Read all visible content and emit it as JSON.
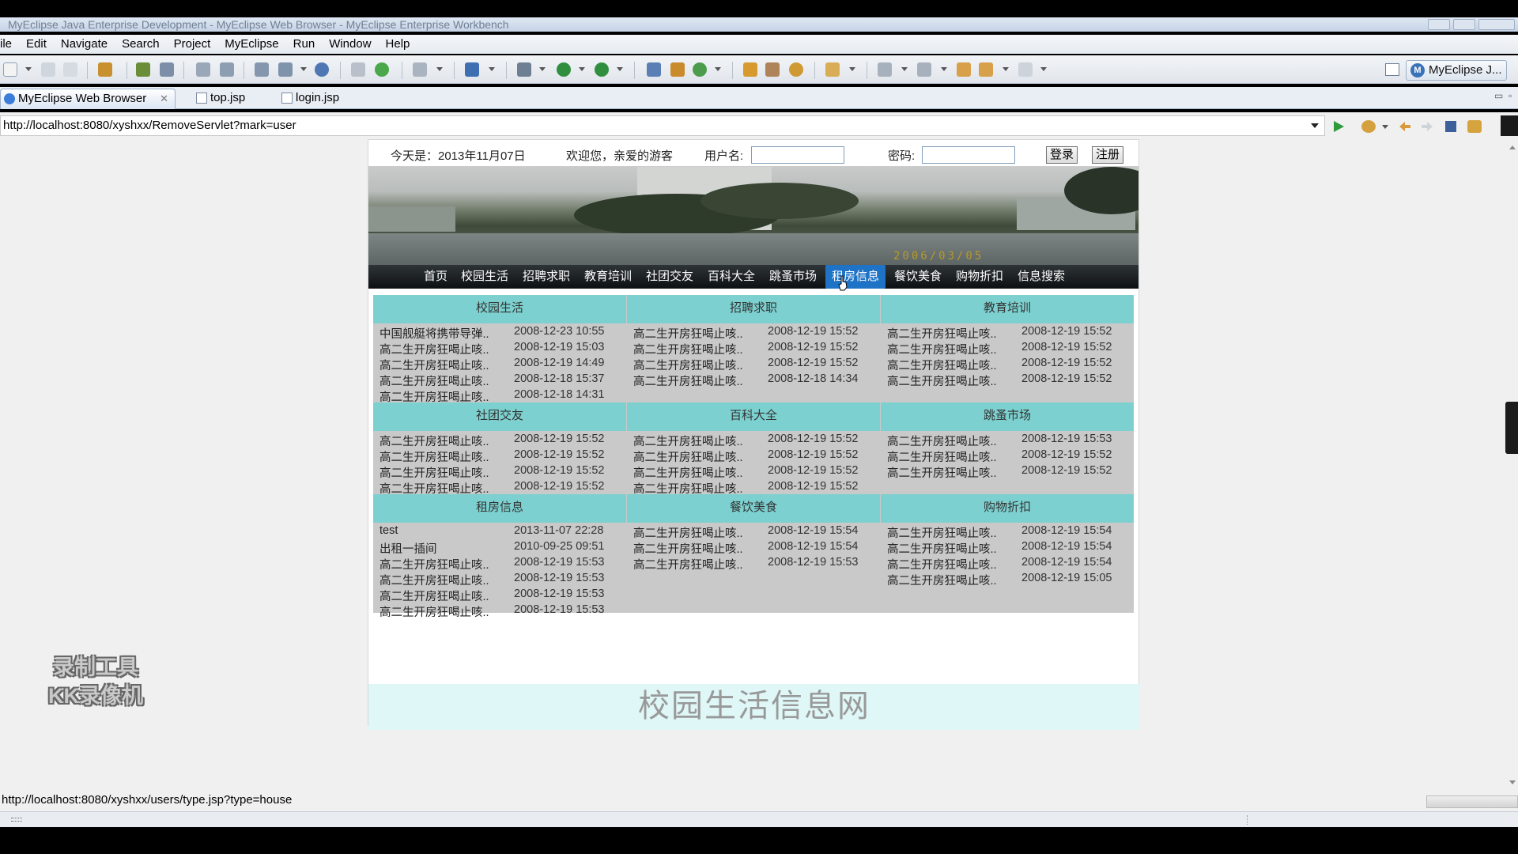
{
  "window": {
    "title": "MyEclipse Java Enterprise Development - MyEclipse Web Browser - MyEclipse Enterprise Workbench"
  },
  "menubar": [
    "ile",
    "Edit",
    "Navigate",
    "Search",
    "Project",
    "MyEclipse",
    "Run",
    "Window",
    "Help"
  ],
  "perspective": {
    "label": "MyEclipse J..."
  },
  "tabs": [
    {
      "label": "MyEclipse Web Browser",
      "close": "✕"
    },
    {
      "label": "top.jsp"
    },
    {
      "label": "login.jsp"
    }
  ],
  "address": {
    "url": "http://localhost:8080/xyshxx/RemoveServlet?mark=user"
  },
  "page": {
    "top": {
      "date_text": "今天是：2013年11月07日",
      "welcome": "欢迎您，亲爱的游客",
      "username_label": "用户名:",
      "username_value": "",
      "password_label": "密码:",
      "password_value": "",
      "login_button": "登录",
      "register_button": "注册"
    },
    "banner_date": "2006/03/05",
    "nav": [
      "首页",
      "校园生活",
      "招聘求职",
      "教育培训",
      "社团交友",
      "百科大全",
      "跳蚤市场",
      "租房信息",
      "餐饮美食",
      "购物折扣",
      "信息搜索"
    ],
    "active_nav": "租房信息",
    "sections": [
      {
        "title": "校园生活",
        "items": [
          {
            "t": "中国舰艇将携带导弹..",
            "d": "2008-12-23 10:55"
          },
          {
            "t": "高二生开房狂喝止咳..",
            "d": "2008-12-19 15:03"
          },
          {
            "t": "高二生开房狂喝止咳..",
            "d": "2008-12-19 14:49"
          },
          {
            "t": "高二生开房狂喝止咳..",
            "d": "2008-12-18 15:37"
          },
          {
            "t": "高二生开房狂喝止咳..",
            "d": "2008-12-18 14:31"
          }
        ]
      },
      {
        "title": "招聘求职",
        "items": [
          {
            "t": "高二生开房狂喝止咳..",
            "d": "2008-12-19 15:52"
          },
          {
            "t": "高二生开房狂喝止咳..",
            "d": "2008-12-19 15:52"
          },
          {
            "t": "高二生开房狂喝止咳..",
            "d": "2008-12-19 15:52"
          },
          {
            "t": "高二生开房狂喝止咳..",
            "d": "2008-12-18 14:34"
          }
        ]
      },
      {
        "title": "教育培训",
        "items": [
          {
            "t": "高二生开房狂喝止咳..",
            "d": "2008-12-19 15:52"
          },
          {
            "t": "高二生开房狂喝止咳..",
            "d": "2008-12-19 15:52"
          },
          {
            "t": "高二生开房狂喝止咳..",
            "d": "2008-12-19 15:52"
          },
          {
            "t": "高二生开房狂喝止咳..",
            "d": "2008-12-19 15:52"
          }
        ]
      },
      {
        "title": "社团交友",
        "items": [
          {
            "t": "高二生开房狂喝止咳..",
            "d": "2008-12-19 15:52"
          },
          {
            "t": "高二生开房狂喝止咳..",
            "d": "2008-12-19 15:52"
          },
          {
            "t": "高二生开房狂喝止咳..",
            "d": "2008-12-19 15:52"
          },
          {
            "t": "高二生开房狂喝止咳..",
            "d": "2008-12-19 15:52"
          }
        ]
      },
      {
        "title": "百科大全",
        "items": [
          {
            "t": "高二生开房狂喝止咳..",
            "d": "2008-12-19 15:52"
          },
          {
            "t": "高二生开房狂喝止咳..",
            "d": "2008-12-19 15:52"
          },
          {
            "t": "高二生开房狂喝止咳..",
            "d": "2008-12-19 15:52"
          },
          {
            "t": "高二生开房狂喝止咳..",
            "d": "2008-12-19 15:52"
          }
        ]
      },
      {
        "title": "跳蚤市场",
        "items": [
          {
            "t": "高二生开房狂喝止咳..",
            "d": "2008-12-19 15:53"
          },
          {
            "t": "高二生开房狂喝止咳..",
            "d": "2008-12-19 15:52"
          },
          {
            "t": "高二生开房狂喝止咳..",
            "d": "2008-12-19 15:52"
          }
        ]
      },
      {
        "title": "租房信息",
        "items": [
          {
            "t": "test",
            "d": "2013-11-07 22:28"
          },
          {
            "t": "出租一插间",
            "d": "2010-09-25 09:51"
          },
          {
            "t": "高二生开房狂喝止咳..",
            "d": "2008-12-19 15:53"
          },
          {
            "t": "高二生开房狂喝止咳..",
            "d": "2008-12-19 15:53"
          },
          {
            "t": "高二生开房狂喝止咳..",
            "d": "2008-12-19 15:53"
          },
          {
            "t": "高二生开房狂喝止咳..",
            "d": "2008-12-19 15:53"
          }
        ]
      },
      {
        "title": "餐饮美食",
        "items": [
          {
            "t": "高二生开房狂喝止咳..",
            "d": "2008-12-19 15:54"
          },
          {
            "t": "高二生开房狂喝止咳..",
            "d": "2008-12-19 15:54"
          },
          {
            "t": "高二生开房狂喝止咳..",
            "d": "2008-12-19 15:53"
          }
        ]
      },
      {
        "title": "购物折扣",
        "items": [
          {
            "t": "高二生开房狂喝止咳..",
            "d": "2008-12-19 15:54"
          },
          {
            "t": "高二生开房狂喝止咳..",
            "d": "2008-12-19 15:54"
          },
          {
            "t": "高二生开房狂喝止咳..",
            "d": "2008-12-19 15:54"
          },
          {
            "t": "高二生开房狂喝止咳..",
            "d": "2008-12-19 15:05"
          }
        ]
      }
    ],
    "footer": "校园生活信息网"
  },
  "watermark": {
    "line1": "录制工具",
    "line2": "KK录像机"
  },
  "status": {
    "url": "http://localhost:8080/xyshxx/users/type.jsp?type=house"
  },
  "colors": {
    "section_header": "#7cd1d0",
    "nav_active": "#1e73c6",
    "footer_bg": "#dff7f7",
    "content_bg": "#c9c9c9"
  }
}
